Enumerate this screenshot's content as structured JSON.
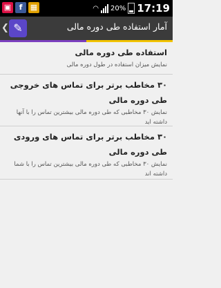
{
  "status_bar": {
    "battery_percent": "20%",
    "time": "17:19",
    "notification_icons": [
      "gallery-icon",
      "facebook-icon",
      "gift-icon"
    ]
  },
  "action_bar": {
    "title": "آمار استفاده طی دوره مالی"
  },
  "colors": {
    "accent_left": "#7b3fbf",
    "accent_right": "#f2c300",
    "app_icon_bg": "#5b46c8",
    "action_bar_bg": "#3b3b3b"
  },
  "settings": [
    {
      "title": "استفاده طی دوره مالی",
      "desc": "نمایش میزان استفاده در طول دوره مالی"
    },
    {
      "title": "۳۰ مخاطب برتر برای تماس های خروجی طی دوره مالی",
      "desc": "نمایش ۳۰ مخاطبی که طی دوره مالی بیشترین تماس را با آنها داشته اید"
    },
    {
      "title": "۳۰ مخاطب برتر برای تماس های ورودی طی دوره مالی",
      "desc": "نمایش ۳۰ مخاطبی که طی دوره مالی بیشترین تماس را با شما داشته اند"
    }
  ]
}
